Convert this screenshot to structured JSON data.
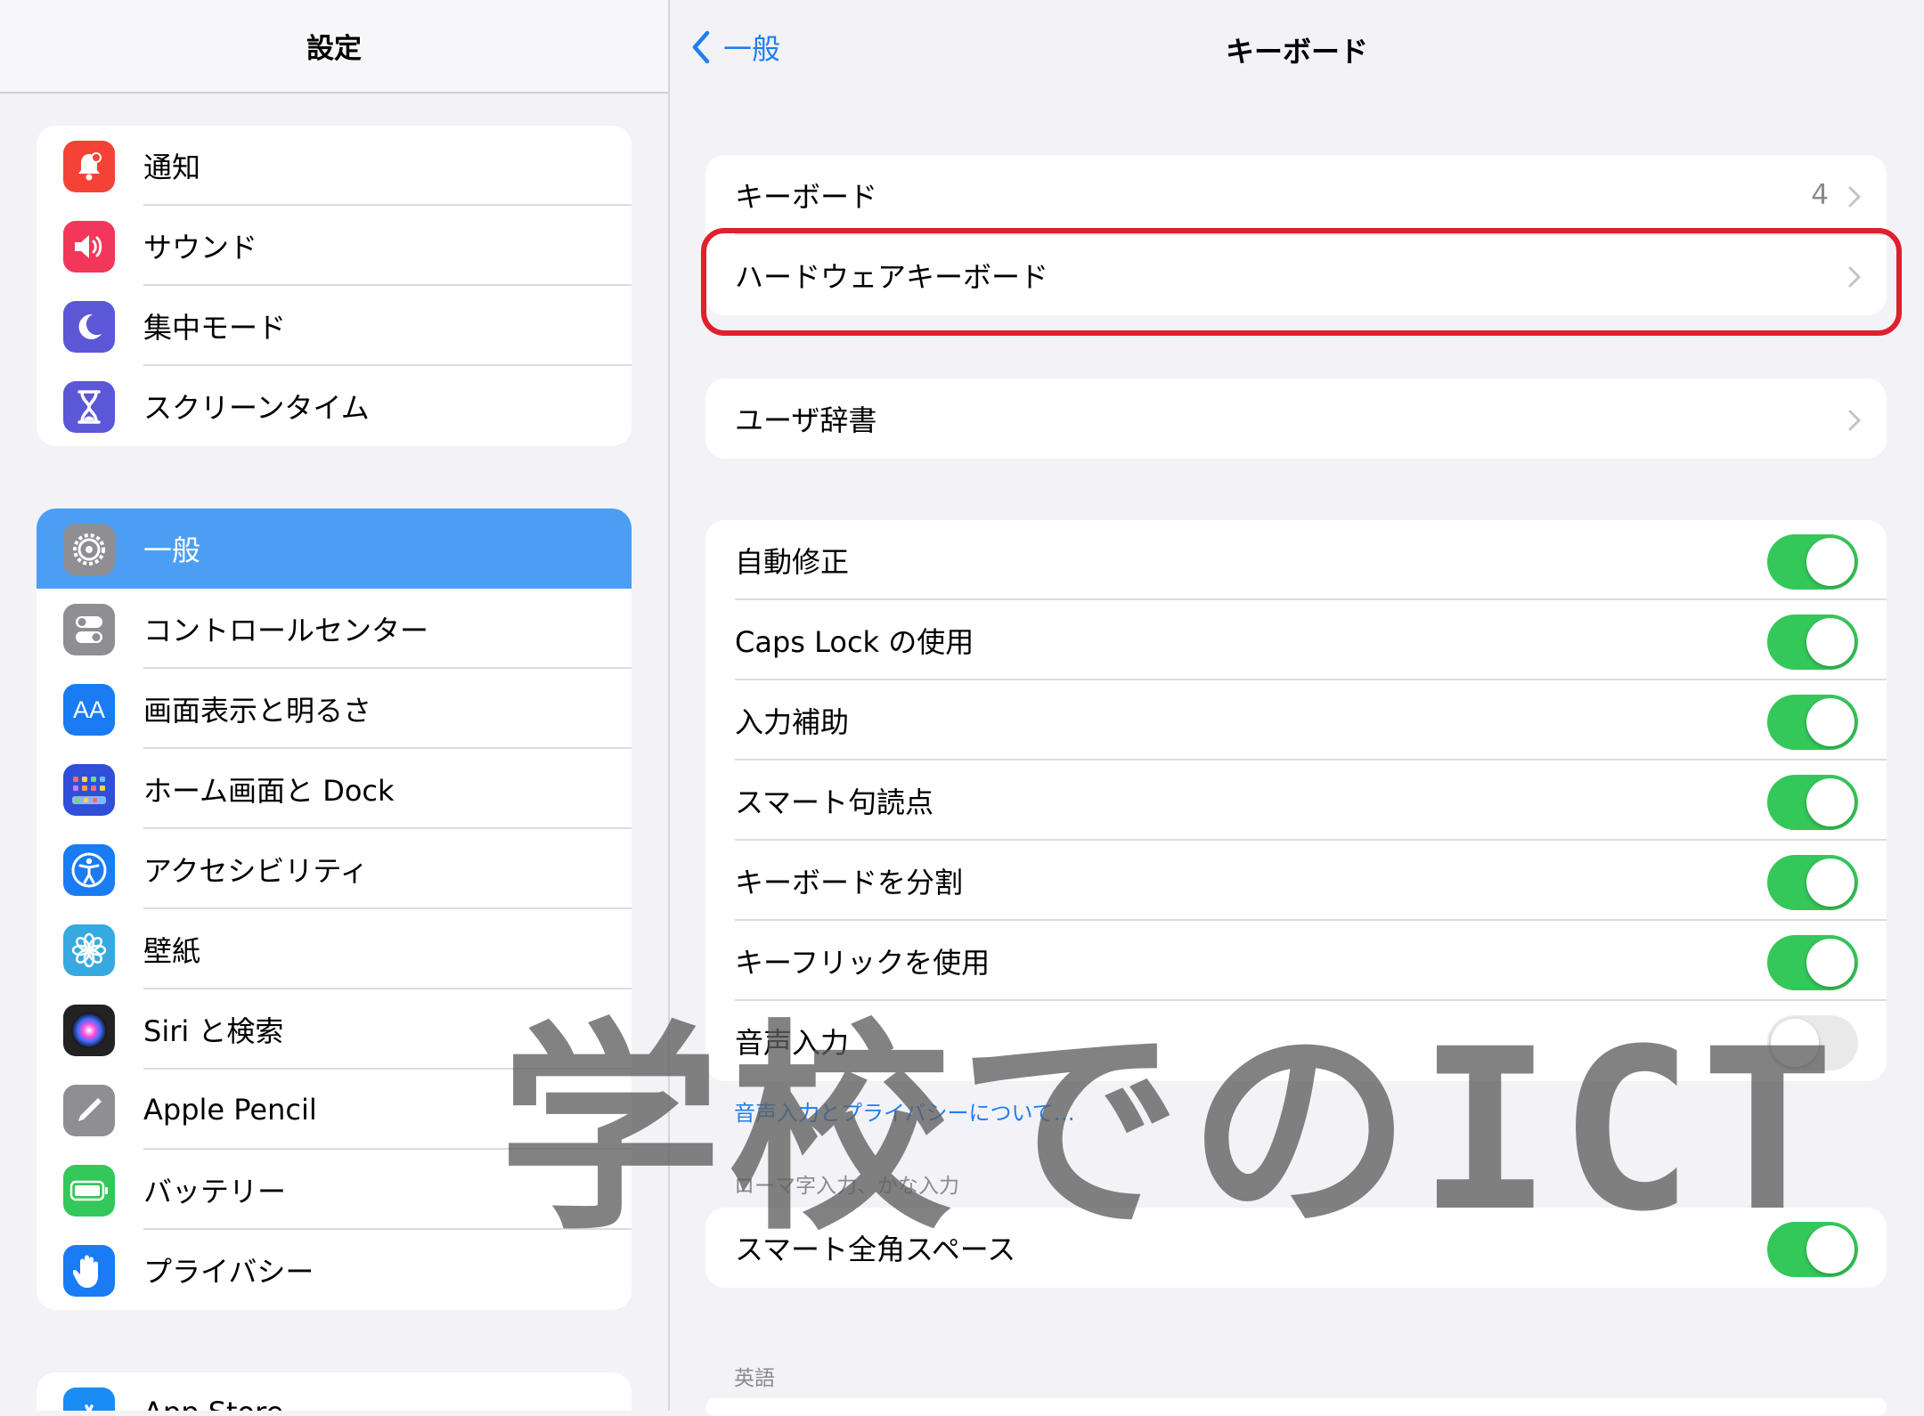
{
  "sidebar": {
    "title": "設定",
    "group1": [
      {
        "label": "通知",
        "icon": "bell-icon",
        "color": "#f44336"
      },
      {
        "label": "サウンド",
        "icon": "speaker-icon",
        "color": "#f2375a"
      },
      {
        "label": "集中モード",
        "icon": "moon-icon",
        "color": "#5c57d6"
      },
      {
        "label": "スクリーンタイム",
        "icon": "hourglass-icon",
        "color": "#5c57d6"
      }
    ],
    "group2": [
      {
        "label": "一般",
        "icon": "gear-icon",
        "color": "#8e8e93",
        "selected": true
      },
      {
        "label": "コントロールセンター",
        "icon": "toggles-icon",
        "color": "#8e8e93"
      },
      {
        "label": "画面表示と明るさ",
        "icon": "text-size-icon",
        "icon_text": "AA",
        "color": "#1a7cf2"
      },
      {
        "label": "ホーム画面と Dock",
        "icon": "home-grid-icon",
        "color": "#2f4fd8"
      },
      {
        "label": "アクセシビリティ",
        "icon": "accessibility-icon",
        "color": "#1a7cf2"
      },
      {
        "label": "壁紙",
        "icon": "flower-icon",
        "color": "#35a9e0"
      },
      {
        "label": "Siri と検索",
        "icon": "siri-icon",
        "color": "#222222"
      },
      {
        "label": "Apple Pencil",
        "icon": "pencil-icon",
        "color": "#8e8e93"
      },
      {
        "label": "バッテリー",
        "icon": "battery-icon",
        "color": "#34c759"
      },
      {
        "label": "プライバシー",
        "icon": "hand-icon",
        "color": "#1a7cf2"
      }
    ],
    "group3": [
      {
        "label": "App Store",
        "icon": "app-store-icon",
        "color": "#1a8cf5"
      }
    ]
  },
  "navbar": {
    "back_label": "一般",
    "title": "キーボード"
  },
  "keyboards_section": {
    "keyboards": {
      "label": "キーボード",
      "value": "4"
    },
    "hardware": {
      "label": "ハードウェアキーボード"
    }
  },
  "dictionary_section": {
    "user_dictionary": {
      "label": "ユーザ辞書"
    }
  },
  "toggles": [
    {
      "label": "自動修正",
      "on": true
    },
    {
      "label": "Caps Lock の使用",
      "on": true
    },
    {
      "label": "入力補助",
      "on": true
    },
    {
      "label": "スマート句読点",
      "on": true
    },
    {
      "label": "キーボードを分割",
      "on": true
    },
    {
      "label": "キーフリックを使用",
      "on": true
    },
    {
      "label": "音声入力",
      "on": false
    }
  ],
  "dictation_privacy_link": "音声入力とプライバシーについて…",
  "romaji_section": {
    "header": "ローマ字入力、かな入力",
    "smart_fullwidth_space": {
      "label": "スマート全角スペース",
      "on": true
    }
  },
  "english_section": {
    "header": "英語"
  },
  "watermark": "学校でのICT",
  "colors": {
    "accent": "#1f7ef2",
    "toggle_on": "#34c759",
    "highlight": "#e0202c",
    "selected_row": "#4c9ef5"
  }
}
